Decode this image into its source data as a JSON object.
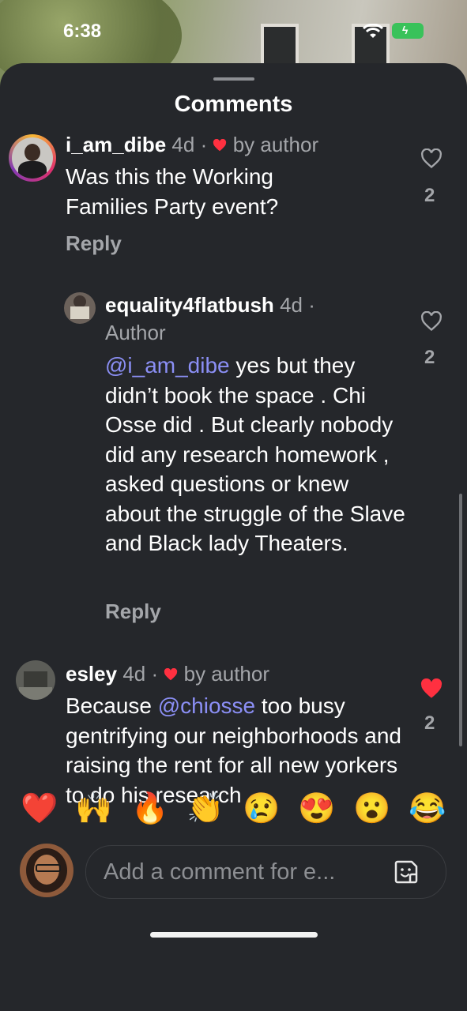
{
  "status_bar": {
    "time": "6:38"
  },
  "sheet": {
    "title": "Comments"
  },
  "comments": [
    {
      "username": "i_am_dibe",
      "age": "4d",
      "liked_by_author": "by author",
      "text": "Was this the Working Families Party event?",
      "reply_label": "Reply",
      "like_count": "2",
      "liked": false
    },
    {
      "username": "equality4flatbush",
      "age": "4d",
      "author_tag": "Author",
      "mention": "@i_am_dibe",
      "text": " yes but they didn’t book the space . Chi Osse did . But clearly nobody did any research homework , asked questions or knew about the struggle of the Slave and Black lady Theaters.",
      "reply_label": "Reply",
      "like_count": "2",
      "liked": false
    },
    {
      "username": "esley",
      "age": "4d",
      "liked_by_author": "by author",
      "text_before": "Because ",
      "mention": "@chiosse",
      "text_after": " too busy gentrifying our neighborhoods and raising the rent for all new yorkers to do his research",
      "like_count": "2",
      "liked": true
    }
  ],
  "emoji_reactions": [
    "❤️",
    "🙌",
    "🔥",
    "👏",
    "😢",
    "😍",
    "😮",
    "😂"
  ],
  "composer": {
    "placeholder": "Add a comment for e..."
  },
  "colors": {
    "background": "#25272b",
    "mention": "#8b8ff5",
    "heart": "#ff3040"
  }
}
